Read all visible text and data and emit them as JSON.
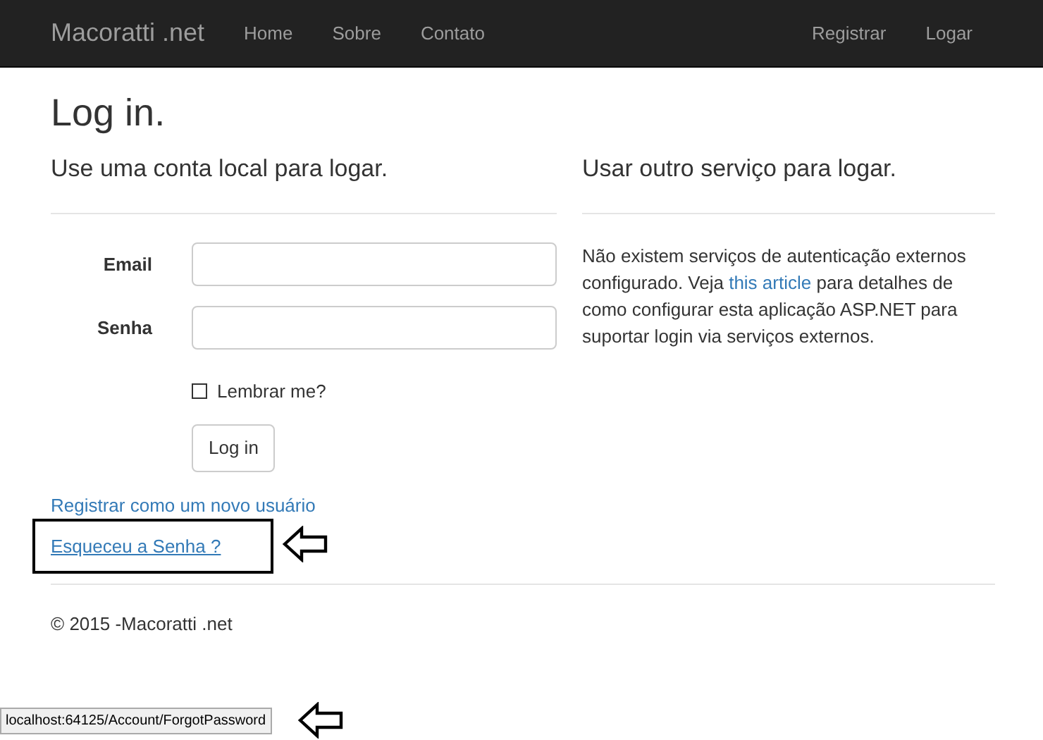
{
  "navbar": {
    "brand": "Macoratti .net",
    "left_links": [
      "Home",
      "Sobre",
      "Contato"
    ],
    "right_links": [
      "Registrar",
      "Logar"
    ]
  },
  "page_title": "Log in.",
  "local_login": {
    "heading": "Use uma conta local para logar.",
    "fields": [
      {
        "label": "Email"
      },
      {
        "label": "Senha"
      }
    ],
    "remember": {
      "label": "Lembrar me?",
      "checked": false
    },
    "submit": "Log in",
    "links": [
      {
        "text": "Registrar como um novo usuário",
        "highlighted": false
      },
      {
        "text": "Esqueceu a Senha ?",
        "highlighted": true
      }
    ]
  },
  "external_login": {
    "heading": "Usar outro serviço para logar.",
    "text_before": "Não existem serviços de autenticação externos configurado. Veja ",
    "link": "this article",
    "text_after": " para detalhes de como configurar esta aplicação ASP.NET para suportar login via serviços externos."
  },
  "footer": "© 2015 -Macoratti .net",
  "status_url": "localhost:64125/Account/ForgotPassword"
}
